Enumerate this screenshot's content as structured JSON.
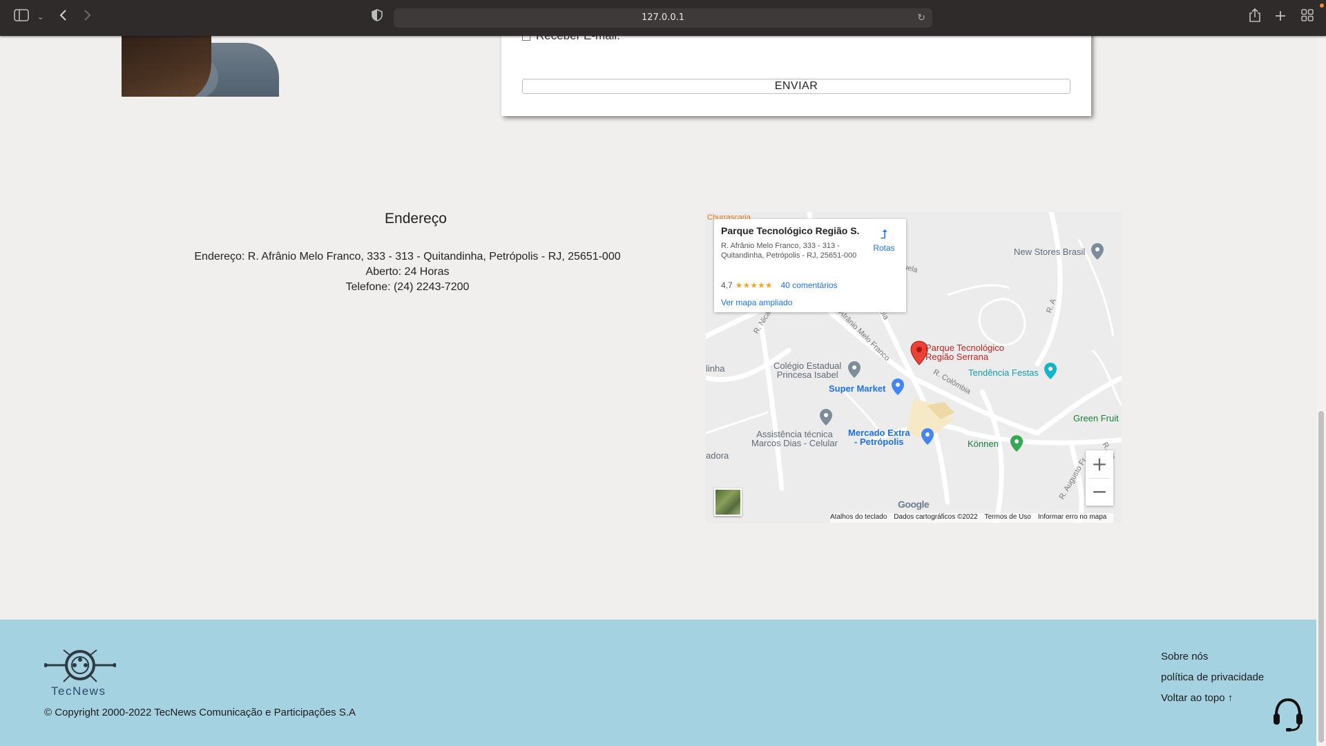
{
  "browser": {
    "url": "127.0.0.1",
    "icons": [
      "sidebar-icon",
      "chevron-down-icon",
      "back-icon",
      "forward-icon",
      "shield-icon",
      "reload-icon",
      "share-icon",
      "plus-icon",
      "tabs-grid-icon"
    ]
  },
  "form": {
    "checkbox_label": "Receber E-mail.",
    "submit_label": "ENVIAR"
  },
  "address": {
    "title": "Endereço",
    "line1": "Endereço: R. Afrânio Melo Franco, 333 - 313 - Quitandinha, Petrópolis - RJ, 25651-000",
    "line2": "Aberto: 24 Horas",
    "line3": "Telefone: (24) 2243-7200"
  },
  "map": {
    "place_name": "Parque Tecnológico Região S...",
    "place_address": "R. Afrânio Melo Franco, 333 - 313 - Quitandinha, Petrópolis - RJ, 25651-000",
    "rating": "4,7",
    "stars": "★★★★★",
    "reviews": "40 comentários",
    "bigger_map": "Ver mapa ampliado",
    "routes": "Rotas",
    "labels": {
      "churrascaria": "Churrascaria",
      "new_stores": "New Stores Brasil",
      "parque": "Parque Tecnológico",
      "parque2": "Região Serrana",
      "colegio": "Colégio Estadual",
      "colegio2": "Princesa Isabel",
      "super_market": "Super Market",
      "tendencia": "Tendência Festas",
      "assistencia": "Assistência técnica",
      "assistencia2": "Marcos Dias - Celular",
      "mercado": "Mercado Extra",
      "mercado2": "- Petrópolis",
      "konnen": "Können",
      "green_fruit": "Green Fruit",
      "linha": "linha",
      "adora": "adora",
      "r_nicaragua": "R. Nicarágua",
      "r_afranio": "R. Afrânio Melo Franco",
      "r_colombia": "R. Colômbia",
      "r_a": "R. A",
      "r_augusto": "R. Augusto Fr",
      "uela": "uela",
      "nbia": "nbia",
      "r_ve": "R. Ve"
    },
    "google": "Google",
    "attribution": [
      "Atalhos do teclado",
      "Dados cartográficos ©2022",
      "Termos de Uso",
      "Informar erro no mapa"
    ],
    "zoom_in": "+",
    "zoom_out": "−"
  },
  "footer": {
    "brand": "TecNews",
    "copyright": "© Copyright 2000-2022 TecNews Comunicação e Participações S.A",
    "links": [
      "Sobre nós",
      "política de privacidade",
      "Voltar ao topo ↑"
    ]
  }
}
